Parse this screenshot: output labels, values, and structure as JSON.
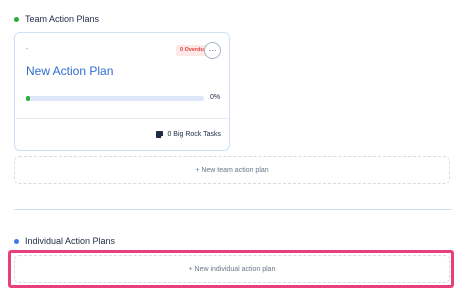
{
  "team_section": {
    "title": "Team Action Plans",
    "dot_color": "#2eaa3a"
  },
  "plan_card": {
    "subtitle": "-",
    "overdue_badge": "0 Overdue",
    "more_icon": "ellipsis-icon",
    "more_label": "···",
    "title": "New Action Plan",
    "progress_value": 0,
    "progress_label": "0%",
    "tasks_icon": "rock-task-icon",
    "tasks_label": "0 Big Rock Tasks"
  },
  "add_team_plan": {
    "label": "+ New team action plan"
  },
  "individual_section": {
    "title": "Individual Action Plans",
    "dot_color": "#3d7be0"
  },
  "add_individual_plan": {
    "label": "+ New individual action plan"
  },
  "colors": {
    "accent_blue": "#2f6dd0",
    "progress_green": "#2eaa3a",
    "overdue_red": "#e0403c",
    "highlight_pink": "#ea3f7d"
  }
}
